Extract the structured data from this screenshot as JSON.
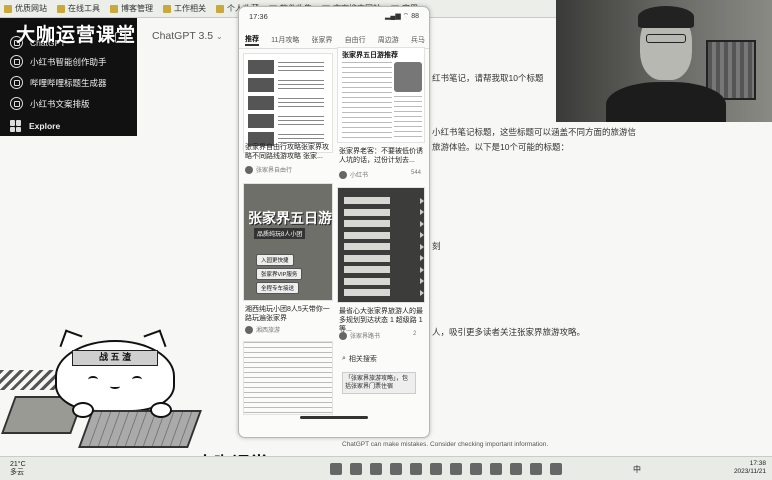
{
  "bookmarks": [
    "优质网站",
    "在线工具",
    "博客管理",
    "工作相关",
    "个人收藏",
    "软件收集",
    "文案搜索网站",
    "实用"
  ],
  "sidebar": {
    "brand_overlay": "大咖运营课堂",
    "items": [
      {
        "label": "ChatGPT"
      },
      {
        "label": "小红书智能创作助手"
      },
      {
        "label": "哔哩哔哩标题生成器"
      },
      {
        "label": "小红书文案排版"
      },
      {
        "label": "Explore"
      }
    ]
  },
  "chat": {
    "model": "ChatGPT 3.5",
    "model_caret": "⌄",
    "line1": "红书笔记，请帮我取10个标题",
    "line2": "小红书笔记标题，这些标题可以涵盖不同方面的旅游信",
    "line3": "旅游体验。以下是10个可能的标题：",
    "line4": "刻",
    "line5": "人，吸引更多读者关注张家界旅游攻略。",
    "disclaimer": "ChatGPT can make mistakes. Consider checking important information."
  },
  "phone": {
    "time": "17:36",
    "status_right": "▂▄▆ ⌔ 88",
    "tabs": [
      "推荐",
      "11月攻略",
      "张家界",
      "自由行",
      "周边游",
      "兵马"
    ],
    "active_tab": "推荐",
    "card1_title": "张家界自由行攻略张家界攻略不同路线游攻略 张家...",
    "card1_user": "张家界自由行",
    "card2_title": "张家界老客：不要被低价诱人坑的话，过份计划去...",
    "card2_user": "小红书",
    "card2_likes": "544",
    "poster_title": "张家界五日游",
    "poster_sub": "品质纯玩8人小团",
    "poster_pills": [
      "入园更快捷",
      "张家界VIP服务",
      "全程专车接送"
    ],
    "card3_title": "湘西纯玩小团8人5天带你一路玩遍张家界",
    "card3_user": "湘西旅游",
    "card4_title": "最省心大张家界旅游人的最多规划到达状态 1 超级路 1 等...",
    "card4_user": "张家界路书",
    "doc_title": "张家界五日游推荐",
    "related": "相关搜索",
    "recommend": "「张家界旅游攻略」，包括张家界门票住宿",
    "likes2": "2"
  },
  "mascot": {
    "band": "战 五 渣"
  },
  "watermark": "大咖课堂",
  "taskbar": {
    "weather_temp": "21°C",
    "weather_desc": "多云",
    "ime": "中",
    "time": "17:38",
    "date": "2023/11/21"
  }
}
